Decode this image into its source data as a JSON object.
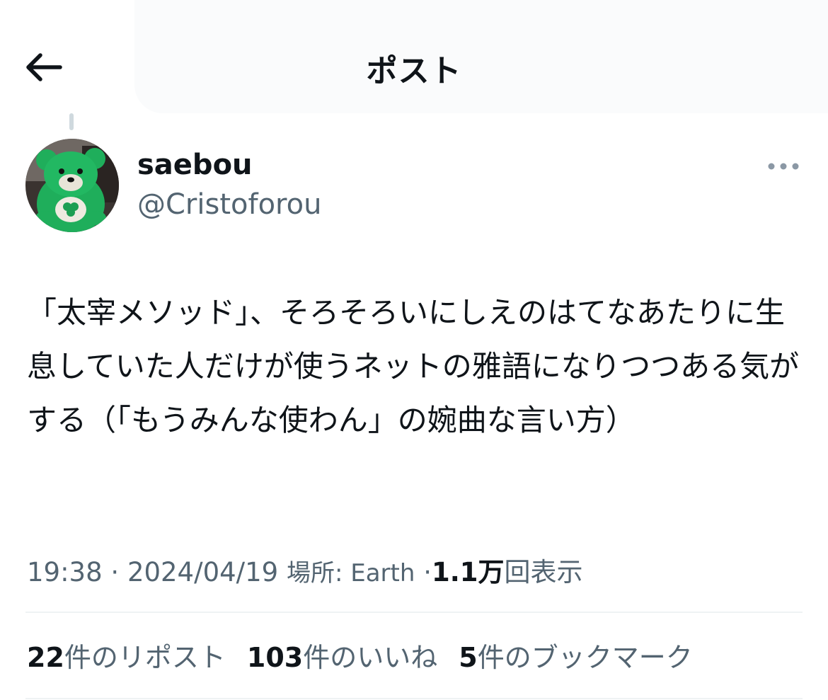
{
  "header": {
    "title": "ポスト",
    "back_icon": "back-arrow-icon"
  },
  "author": {
    "display_name": "saebou",
    "handle": "@Cristoforou",
    "avatar": "green-teddy-bear-avatar",
    "more_icon": "more-options-icon"
  },
  "post": {
    "text": "「太宰メソッド」、そろそろいにしえのはてなあたりに生息していた人だけが使うネットの雅語になりつつある気がする（「もうみんな使わん」の婉曲な言い方）"
  },
  "meta": {
    "time": "19:38",
    "separator": "·",
    "date": "2024/04/19",
    "location_label": "場所: Earth",
    "views_count": "1.1万",
    "views_label": "回表示"
  },
  "stats": {
    "reposts": {
      "count": "22",
      "label": "件のリポスト"
    },
    "likes": {
      "count": "103",
      "label": "件のいいね"
    },
    "bookmarks": {
      "count": "5",
      "label": "件のブックマーク"
    }
  },
  "colors": {
    "text_primary": "#0f1419",
    "text_secondary": "#536471",
    "divider": "#eff3f4",
    "avatar_green": "#1fae5b"
  }
}
